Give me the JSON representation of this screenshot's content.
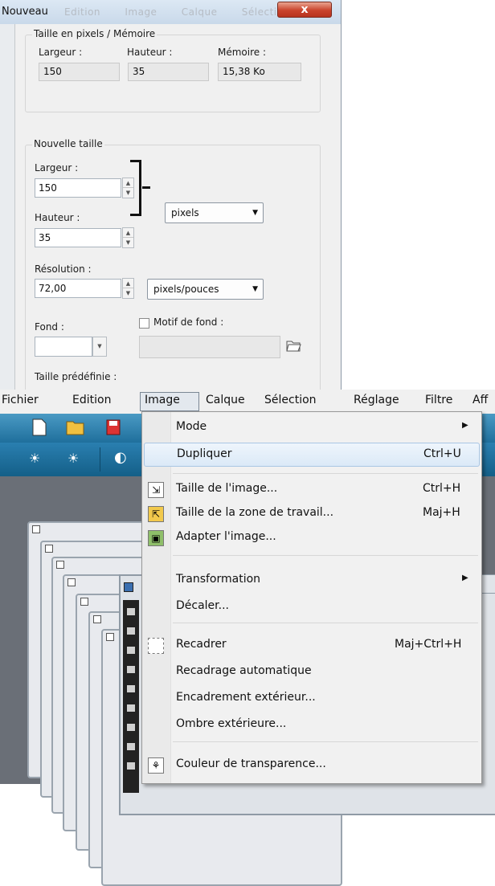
{
  "dialog": {
    "title": "Nouveau",
    "background_menu": [
      "Edition",
      "Image",
      "Calque",
      "Sélection"
    ],
    "close_symbol": "x",
    "current": {
      "legend": "Taille en pixels / Mémoire",
      "width_label": "Largeur :",
      "height_label": "Hauteur :",
      "memory_label": "Mémoire :",
      "width_value": "150",
      "height_value": "35",
      "memory_value": "15,38 Ko"
    },
    "new_size": {
      "legend": "Nouvelle taille",
      "width_label": "Largeur :",
      "width_value": "150",
      "height_label": "Hauteur :",
      "height_value": "35",
      "unit_value": "pixels",
      "resolution_label": "Résolution :",
      "resolution_value": "72,00",
      "resolution_unit": "pixels/pouces",
      "background_label": "Fond :",
      "pattern_label": "Motif de fond :",
      "preset_label": "Taille prédéfinie :"
    }
  },
  "menubar": {
    "items": [
      "Fichier",
      "Edition",
      "Image",
      "Calque",
      "Sélection",
      "Réglage",
      "Filtre",
      "Aff"
    ]
  },
  "image_menu": {
    "items": [
      {
        "label": "Mode",
        "shortcut": "",
        "submenu": true
      },
      {
        "label": "Dupliquer",
        "shortcut": "Ctrl+U",
        "highlighted": true
      },
      {
        "label": "Taille de l'image...",
        "shortcut": "Ctrl+H",
        "icon": "resize-image-icon"
      },
      {
        "label": "Taille de la zone de travail...",
        "shortcut": "Maj+H",
        "icon": "canvas-size-icon"
      },
      {
        "label": "Adapter l'image...",
        "shortcut": "",
        "icon": "fit-image-icon"
      },
      {
        "label": "Transformation",
        "shortcut": "",
        "submenu": true
      },
      {
        "label": "Décaler...",
        "shortcut": ""
      },
      {
        "label": "Recadrer",
        "shortcut": "Maj+Ctrl+H",
        "icon": "crop-icon"
      },
      {
        "label": "Recadrage automatique",
        "shortcut": ""
      },
      {
        "label": "Encadrement extérieur...",
        "shortcut": ""
      },
      {
        "label": "Ombre extérieure...",
        "shortcut": ""
      },
      {
        "label": "Couleur de transparence...",
        "shortcut": "",
        "icon": "transparency-icon"
      }
    ]
  },
  "colors": {
    "menu_highlight": "#dbe9f7",
    "toolbar_blue": "#1f6f9c",
    "close_button": "#c9432c"
  }
}
